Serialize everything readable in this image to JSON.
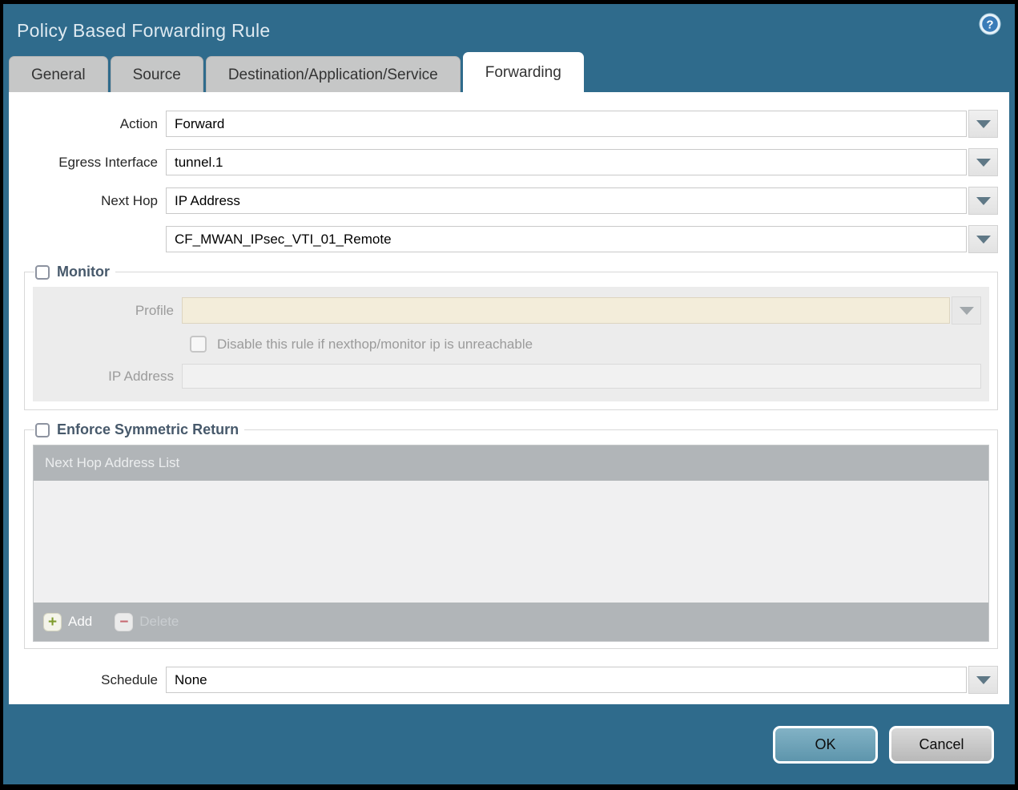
{
  "window": {
    "title": "Policy Based Forwarding Rule"
  },
  "tabs": [
    {
      "label": "General",
      "active": false
    },
    {
      "label": "Source",
      "active": false
    },
    {
      "label": "Destination/Application/Service",
      "active": false
    },
    {
      "label": "Forwarding",
      "active": true
    }
  ],
  "form": {
    "action": {
      "label": "Action",
      "value": "Forward"
    },
    "egress_interface": {
      "label": "Egress Interface",
      "value": "tunnel.1"
    },
    "next_hop": {
      "label": "Next Hop",
      "value": "IP Address"
    },
    "next_hop_address": {
      "value": "CF_MWAN_IPsec_VTI_01_Remote"
    },
    "schedule": {
      "label": "Schedule",
      "value": "None"
    }
  },
  "monitor": {
    "legend": "Monitor",
    "checked": false,
    "profile": {
      "label": "Profile",
      "value": ""
    },
    "disable_rule": {
      "label": "Disable this rule if nexthop/monitor ip is unreachable",
      "checked": false
    },
    "ip_address": {
      "label": "IP Address",
      "value": ""
    }
  },
  "enforce_symmetric_return": {
    "legend": "Enforce Symmetric Return",
    "checked": false,
    "table": {
      "header": "Next Hop Address List",
      "rows": []
    },
    "add_label": "Add",
    "delete_label": "Delete"
  },
  "footer": {
    "ok_label": "OK",
    "cancel_label": "Cancel"
  },
  "colors": {
    "chrome_teal": "#2f6b8c",
    "ok_button": "#6fa7bc",
    "profile_field_bg": "#f3edda",
    "table_bar_gray": "#b1b5b8",
    "add_plus_green": "#7f9c2e",
    "delete_minus_red": "#c76a72"
  }
}
